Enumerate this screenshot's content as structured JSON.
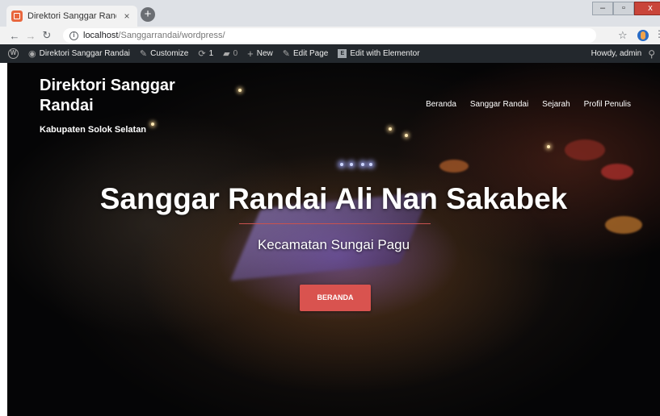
{
  "browser": {
    "tab_title": "Direktori Sanggar Randai – Kabu",
    "tab_close": "×",
    "new_tab": "+",
    "url_host": "localhost",
    "url_path": "/Sanggarrandai/wordpress/",
    "win_minimize": "–",
    "win_maximize": "▫",
    "win_close": "x"
  },
  "admin_bar": {
    "site_name": "Direktori Sanggar Randai",
    "customize": "Customize",
    "updates_count": "1",
    "comments_count": "0",
    "new": "New",
    "edit_page": "Edit Page",
    "edit_elementor": "Edit with Elementor",
    "howdy": "Howdy, admin"
  },
  "site": {
    "title": "Direktori Sanggar Randai",
    "tagline": "Kabupaten Solok Selatan",
    "nav": [
      "Beranda",
      "Sanggar Randai",
      "Sejarah",
      "Profil Penulis"
    ]
  },
  "hero": {
    "title": "Sanggar Randai Ali Nan Sakabek",
    "subtitle": "Kecamatan Sungai Pagu",
    "button_label": "BERANDA"
  },
  "colors": {
    "admin_bar": "#23282d",
    "button": "#d9534f",
    "divider": "#c9524f"
  }
}
